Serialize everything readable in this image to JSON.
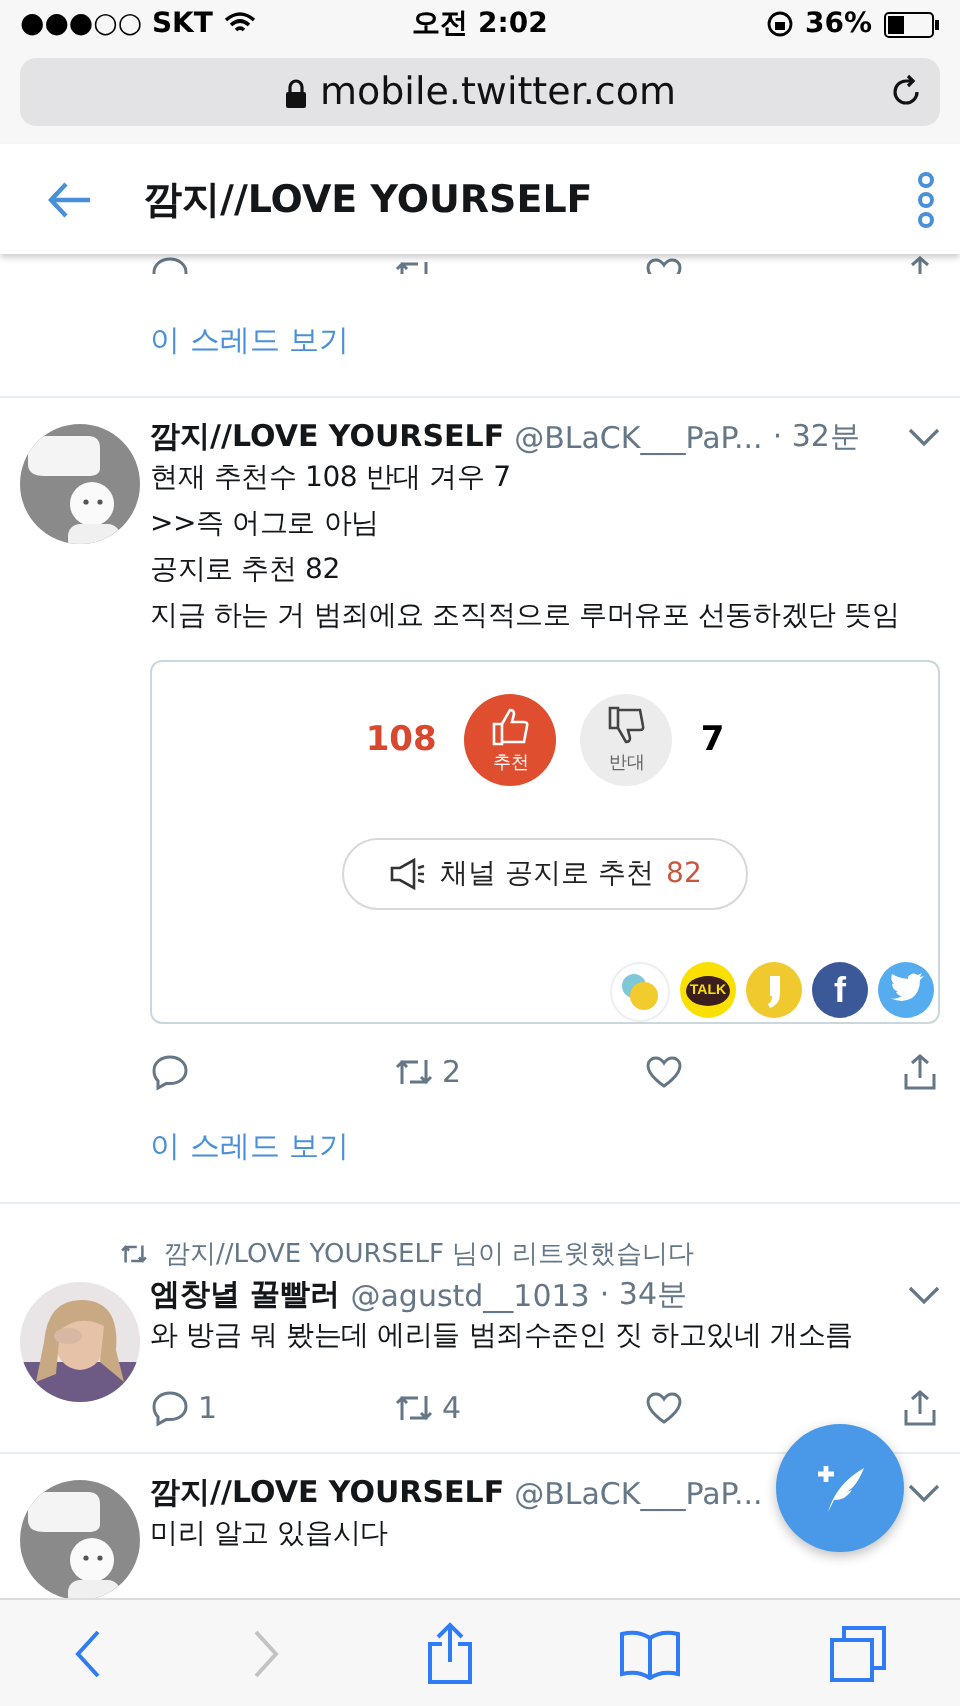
{
  "status_bar": {
    "carrier": "●●●○○ SKT",
    "time": "오전 2:02",
    "battery": "36%"
  },
  "address_bar": {
    "url": "mobile.twitter.com"
  },
  "header": {
    "title": "깜지//LOVE YOURSELF"
  },
  "feed": [
    {
      "kind": "thread_tail",
      "thread_link": "이 스레드 보기"
    },
    {
      "kind": "tweet",
      "name": "깜지//LOVE YOURSELF",
      "handle": "@BLaCK___PaP...",
      "time": "· 32분",
      "lines": [
        "현재 추천수 108 반대 겨우 7",
        ">>즉 어그로 아님",
        "공지로 추천 82",
        "지금 하는 거 범죄에요 조직적으로 루머유포 선동하겠단 뜻임"
      ],
      "card": {
        "up_count": "108",
        "up_label": "추천",
        "down_label": "반대",
        "down_count": "7",
        "channel_label": "채널 공지로 추천",
        "channel_count": "82",
        "share": [
          {
            "kind": "bubbles"
          },
          {
            "kind": "talk",
            "label": "TALK"
          },
          {
            "kind": "story"
          },
          {
            "kind": "facebook",
            "label": "f"
          },
          {
            "kind": "twitter"
          }
        ]
      },
      "actions": [
        {
          "kind": "reply"
        },
        {
          "kind": "retweet",
          "count": "2"
        },
        {
          "kind": "like"
        },
        {
          "kind": "share"
        }
      ],
      "thread_link": "이 스레드 보기"
    },
    {
      "kind": "tweet",
      "retweeted_by": "깜지//LOVE YOURSELF 님이 리트윗했습니다",
      "name": "엠창녈 꿀빨러",
      "handle": "@agustd__1013",
      "time": "· 34분",
      "lines": [
        "와 방금 뭐 봤는데 에리들 범죄수준인 짓 하고있네 개소름"
      ],
      "actions": [
        {
          "kind": "reply",
          "count": "1"
        },
        {
          "kind": "retweet",
          "count": "4"
        },
        {
          "kind": "like"
        },
        {
          "kind": "share"
        }
      ]
    },
    {
      "kind": "tweet",
      "name": "깜지//LOVE YOURSELF",
      "handle": "@BLaCK___PaP...",
      "lines": [
        "미리 알고 있읍시다"
      ]
    }
  ],
  "toolbar": [
    {
      "kind": "back",
      "disabled": false
    },
    {
      "kind": "forward",
      "disabled": true
    },
    {
      "kind": "share",
      "disabled": false
    },
    {
      "kind": "bookmarks",
      "disabled": false
    },
    {
      "kind": "tabs",
      "disabled": false
    }
  ]
}
